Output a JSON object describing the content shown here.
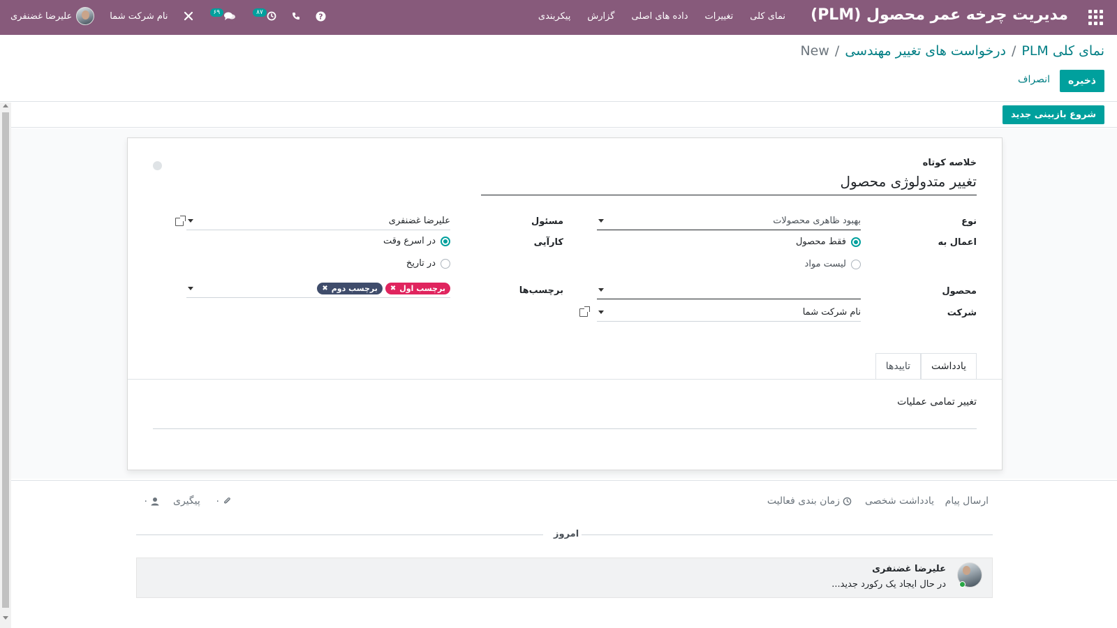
{
  "navbar": {
    "brand": "مدیریت چرخه عمر محصول (PLM)",
    "menu": [
      "نمای کلی",
      "تغییرات",
      "داده های اصلی",
      "گزارش",
      "پیکربندی"
    ],
    "company": "نام شرکت شما",
    "user": "علیرضا غضنفری",
    "activity_count": "۸۷",
    "message_count": "۶۹"
  },
  "breadcrumb": {
    "root": "نمای کلی PLM",
    "parent": "درخواست های تغییر مهندسی",
    "current": "New",
    "sep": "/"
  },
  "actions": {
    "save": "ذخیره",
    "discard": "انصراف"
  },
  "statusbar": {
    "start_review": "شروع بازبینی جدید"
  },
  "form": {
    "summary_label": "خلاصه کوتاه",
    "summary_value": "تغییر متدولوژی محصول",
    "type_label": "نوع",
    "type_value": "بهبود ظاهری محصولات",
    "apply_label": "اعمال به",
    "apply_options": [
      "فقط محصول",
      "لیست مواد"
    ],
    "apply_selected": "فقط محصول",
    "product_label": "محصول",
    "product_value": "",
    "company_label": "شرکت",
    "company_value": "نام شرکت شما",
    "responsible_label": "مسئول",
    "responsible_value": "علیرضا غضنفری",
    "effectivity_label": "کارآیی",
    "effectivity_options": [
      "در اسرع وقت",
      "در تاریخ"
    ],
    "effectivity_selected": "در اسرع وقت",
    "tags_label": "برچسب‌ها",
    "tags": [
      {
        "name": "برچسب اول",
        "color": "#e0245e"
      },
      {
        "name": "برچسب دوم",
        "color": "#3f4c6b"
      }
    ]
  },
  "tabs": [
    {
      "label": "یادداشت",
      "active": true
    },
    {
      "label": "تاییدها",
      "active": false
    }
  ],
  "note": {
    "text": "تغییر تمامی عملیات"
  },
  "chatter": {
    "send_message": "ارسال پیام",
    "log_note": "یادداشت شخصی",
    "schedule_activity": "زمان بندی فعالیت",
    "follow": "پیگیری",
    "attachments_count": "۰",
    "followers_count": "۰",
    "today": "امروز",
    "message_author": "علیرضا غضنفری",
    "message_body": "در حال ایجاد یک رکورد جدید..."
  },
  "colors": {
    "brand": "#875a7b",
    "accent": "#00a09d",
    "link": "#017e84"
  }
}
